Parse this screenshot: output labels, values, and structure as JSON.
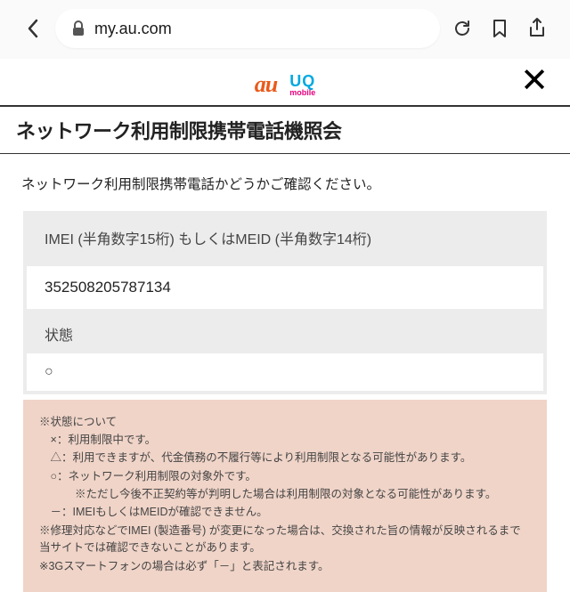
{
  "browser": {
    "url": "my.au.com"
  },
  "logos": {
    "au": "au",
    "uq_top": "UQ",
    "uq_bot": "mobile"
  },
  "close": "✕",
  "title": "ネットワーク利用制限携帯電話機照会",
  "instruction": "ネットワーク利用制限携帯電話かどうかご確認ください。",
  "form": {
    "imei_label": "IMEI (半角数字15桁) もしくはMEID (半角数字14桁)",
    "imei_value": "352508205787134",
    "status_label": "状態",
    "status_value": "○"
  },
  "notes": {
    "heading": "※状態について",
    "items": [
      {
        "sym": "×：",
        "text": "利用制限中です。"
      },
      {
        "sym": "△：",
        "text": "利用できますが、代金債務の不履行等により利用制限となる可能性があります。"
      },
      {
        "sym": "○：",
        "text": "ネットワーク利用制限の対象外です。"
      }
    ],
    "sub_note": "※ただし今後不正契約等が判明した場合は利用制限の対象となる可能性があります。",
    "dash": {
      "sym": "－：",
      "text": "IMEIもしくはMEIDが確認できません。"
    },
    "footer1": "※修理対応などでIMEI (製造番号) が変更になった場合は、交換された旨の情報が反映されるまで当サイトでは確認できないことがあります。",
    "footer2": "※3Gスマートフォンの場合は必ず「－」と表記されます。"
  }
}
